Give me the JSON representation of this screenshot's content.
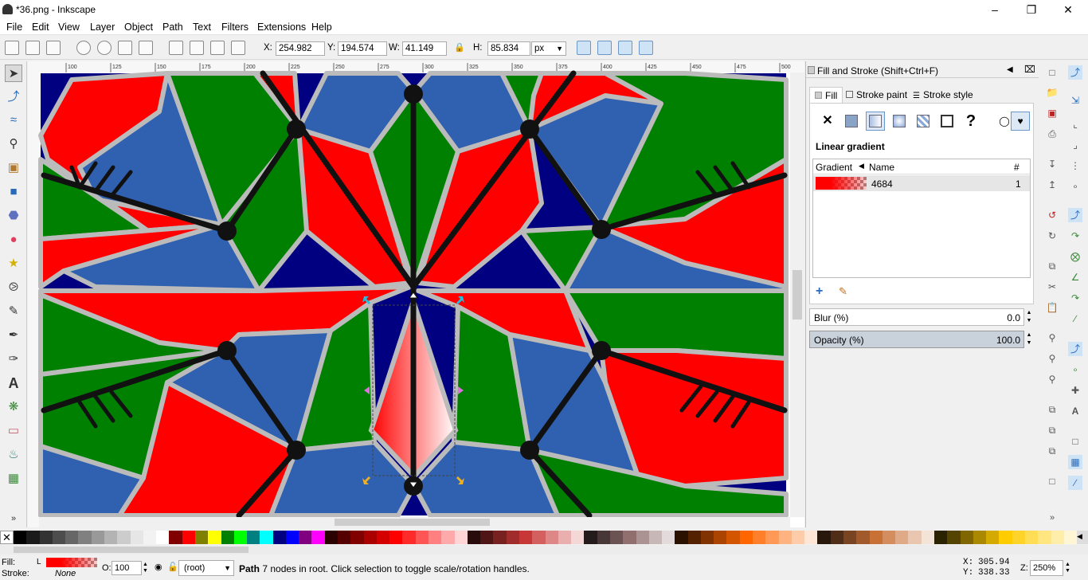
{
  "window": {
    "title": "*36.png - Inkscape"
  },
  "menu": [
    "File",
    "Edit",
    "View",
    "Layer",
    "Object",
    "Path",
    "Text",
    "Filters",
    "Extensions",
    "Help"
  ],
  "toolbar": {
    "x_label": "X:",
    "x": "254.982",
    "y_label": "Y:",
    "y": "194.574",
    "w_label": "W:",
    "w": "41.149",
    "h_label": "H:",
    "h": "85.834",
    "unit": "px"
  },
  "ruler": {
    "ticks": [
      "100",
      "125",
      "150",
      "175",
      "200",
      "225",
      "250",
      "275",
      "300",
      "325",
      "350",
      "375",
      "400",
      "425",
      "450",
      "475",
      "500"
    ]
  },
  "dock": {
    "title": "Fill and Stroke (Shift+Ctrl+F)",
    "tabs": [
      {
        "label": "Fill"
      },
      {
        "label": "Stroke paint"
      },
      {
        "label": "Stroke style"
      }
    ],
    "paint_mode": "Linear gradient",
    "gradient_headers": {
      "gradient": "Gradient",
      "name": "Name",
      "count": "#"
    },
    "gradient_rows": [
      {
        "name": "4684",
        "count": "1"
      }
    ],
    "blur_label": "Blur (%)",
    "blur": "0.0",
    "opacity_label": "Opacity (%)",
    "opacity": "100.0"
  },
  "status": {
    "fill_label": "Fill:",
    "fill_type": "L",
    "stroke_label": "Stroke:",
    "stroke_value": "None",
    "o_label": "O:",
    "opacity": "100",
    "layer": "(root)",
    "message_bold": "Path",
    "message": " 7 nodes in root. Click selection to toggle scale/rotation handles.",
    "x_label": "X:",
    "cx": "305.94",
    "y_label": "Y:",
    "cy": "338.33",
    "z_label": "Z:",
    "zoom": "250%"
  },
  "colors": {
    "red": "#ff0000",
    "green": "#008000",
    "blue": "#3060b0",
    "navy": "#000080",
    "accent": "#e81010"
  }
}
